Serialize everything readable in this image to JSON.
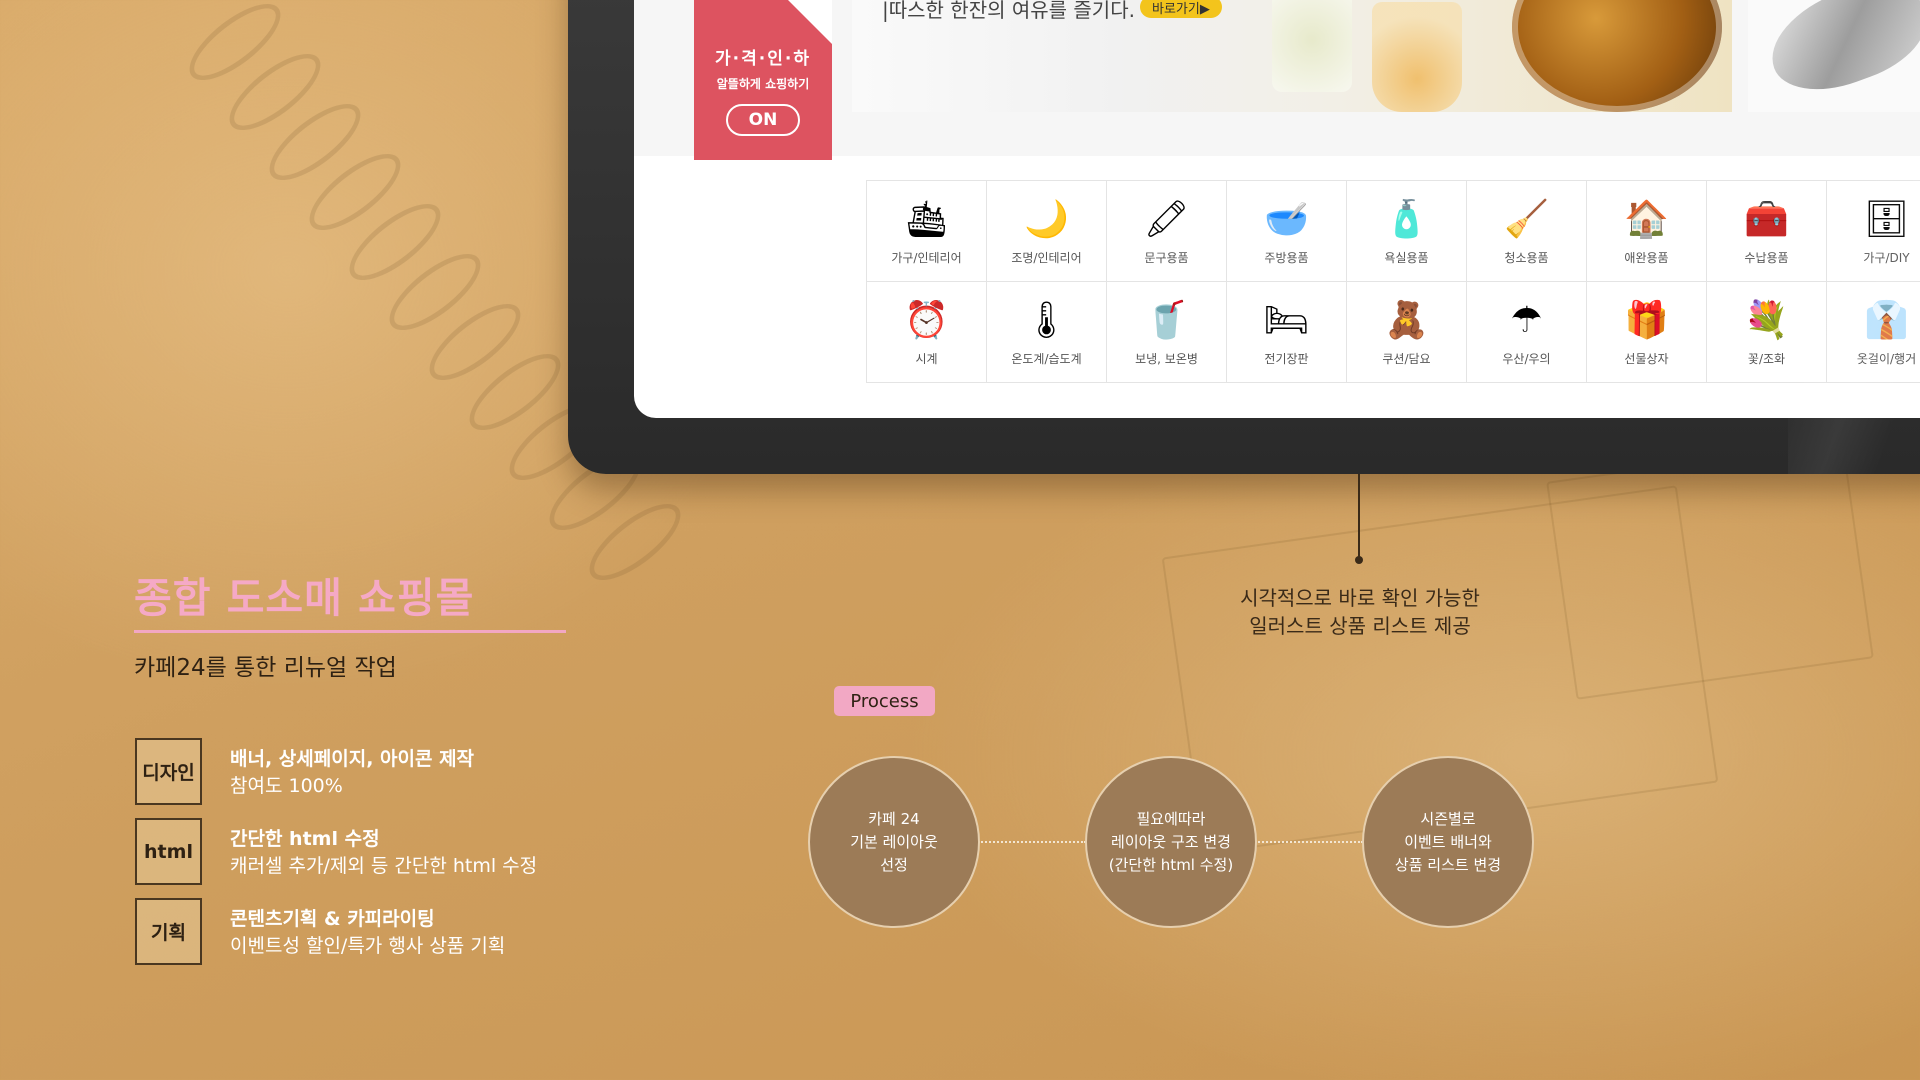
{
  "tablet": {
    "sale_tag": {
      "title": "가·격·인·하",
      "subtitle": "알뜰하게 쇼핑하기",
      "button": "ON"
    },
    "promo": {
      "text": "|따스한 한잔의 여유를 즐기다.",
      "button": "바로가기▶"
    },
    "categories": [
      {
        "label": "가구/인테리어",
        "icon": "🛳"
      },
      {
        "label": "조명/인테리어",
        "icon": "🌙"
      },
      {
        "label": "문구용품",
        "icon": "🖍"
      },
      {
        "label": "주방용품",
        "icon": "🥣"
      },
      {
        "label": "욕실용품",
        "icon": "🧴"
      },
      {
        "label": "청소용품",
        "icon": "🧹"
      },
      {
        "label": "애완용품",
        "icon": "🏠"
      },
      {
        "label": "수납용품",
        "icon": "🧰"
      },
      {
        "label": "가구/DIY",
        "icon": "🗄"
      },
      {
        "label": "시계",
        "icon": "⏰"
      },
      {
        "label": "온도계/습도계",
        "icon": "🌡"
      },
      {
        "label": "보냉, 보온병",
        "icon": "🥤"
      },
      {
        "label": "전기장판",
        "icon": "🛏"
      },
      {
        "label": "쿠션/담요",
        "icon": "🧸"
      },
      {
        "label": "우산/우의",
        "icon": "☂"
      },
      {
        "label": "선물상자",
        "icon": "🎁"
      },
      {
        "label": "꽃/조화",
        "icon": "💐"
      },
      {
        "label": "옷걸이/행거",
        "icon": "👔"
      }
    ]
  },
  "callout": {
    "line1": "시각적으로 바로 확인 가능한",
    "line2": "일러스트 상품 리스트 제공"
  },
  "project": {
    "title": "종합 도소매 쇼핑몰",
    "subtitle": "카페24를 통한 리뉴얼 작업"
  },
  "features": [
    {
      "badge": "디자인",
      "head": "배너, 상세페이지, 아이콘 제작",
      "desc": "참여도 100%"
    },
    {
      "badge": "html",
      "head": "간단한 html 수정",
      "desc": "캐러셀 추가/제외 등 간단한 html 수정"
    },
    {
      "badge": "기획",
      "head": "콘텐츠기획 & 카피라이팅",
      "desc": "이벤트성 할인/특가 행사 상품 기획"
    }
  ],
  "process": {
    "label": "Process",
    "steps": [
      "카페 24\n기본 레이아웃\n선정",
      "필요에따라\n레이아웃 구조 변경\n(간단한 html 수정)",
      "시즌별로\n이벤트 배너와\n상품 리스트 변경"
    ]
  }
}
